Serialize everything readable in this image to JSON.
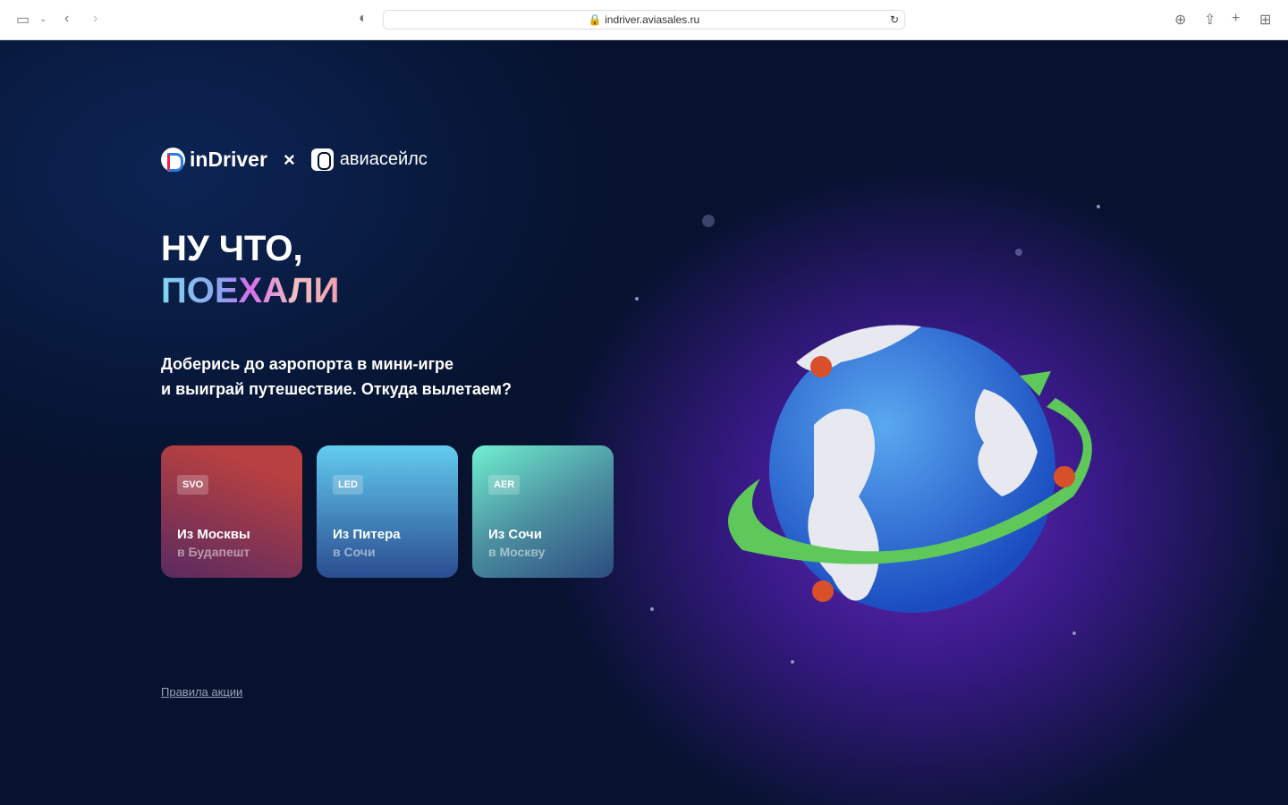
{
  "browser": {
    "url": "indriver.aviasales.ru"
  },
  "header": {
    "brand_left": "inDriver",
    "separator": "×",
    "brand_right": "авиасейлс"
  },
  "hero": {
    "title_line1": "НУ ЧТО,",
    "title_line2": "ПОЕХАЛИ",
    "subtitle_line1": "Доберись до аэропорта в мини-игре",
    "subtitle_line2": "и выиграй путешествие. Откуда вылетаем?"
  },
  "routes": [
    {
      "code": "SVO",
      "from": "Из Москвы",
      "to": "в Будапешт"
    },
    {
      "code": "LED",
      "from": "Из Питера",
      "to": "в Сочи"
    },
    {
      "code": "AER",
      "from": "Из Сочи",
      "to": "в Москву"
    }
  ],
  "footer": {
    "rules_link": "Правила акции"
  }
}
